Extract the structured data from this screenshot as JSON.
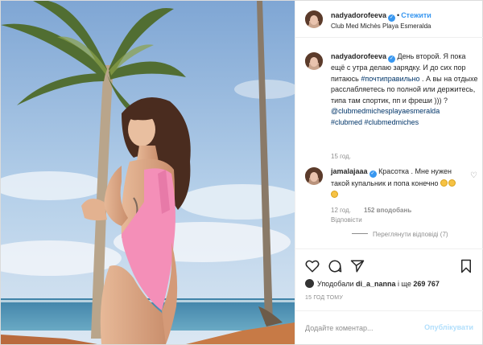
{
  "post": {
    "author": "nadyadorofeeva",
    "follow_label": "Стежити",
    "location": "Club Med Michès Playa Esmeralda",
    "caption": {
      "author": "nadyadorofeeva",
      "text_1": "День второй. Я пока ещё с утра делаю зарядку. И до сих пор питаюсь ",
      "hashtag_1": "#почтиправильно",
      "text_2": " . А вы на отдыхе расслабляетесь по полной или держитесь, типа там спортик, пп и фреши ))) ?",
      "mention": "@clubmedmichesplayaesmeralda",
      "hashtag_2": "#clubmed",
      "hashtag_3": "#clubmedmiches",
      "time": "15 год."
    },
    "comment": {
      "author": "jamalajaaa",
      "text": "Красотка . Мне нужен такой купальник и попа конечно",
      "time": "12 год.",
      "likes": "152 вподобань",
      "reply_label": "Відповісти",
      "view_replies": "Переглянути відповіді (7)"
    },
    "liked_by": {
      "prefix": "Уподобали",
      "user": "di_a_nanna",
      "suffix": "і ще",
      "count": "269 767"
    },
    "posted_ago": "15 ГОД ТОМУ",
    "add_comment_placeholder": "Додайте коментар...",
    "publish_label": "Опублікувати"
  },
  "icons": [
    "heart-icon",
    "comment-icon",
    "share-icon",
    "bookmark-icon",
    "verified-icon"
  ],
  "colors": {
    "accent": "#3897f0",
    "muted": "#8e8e8e",
    "swimsuit": "#f48fb8",
    "sky": "#9ec3e6"
  }
}
